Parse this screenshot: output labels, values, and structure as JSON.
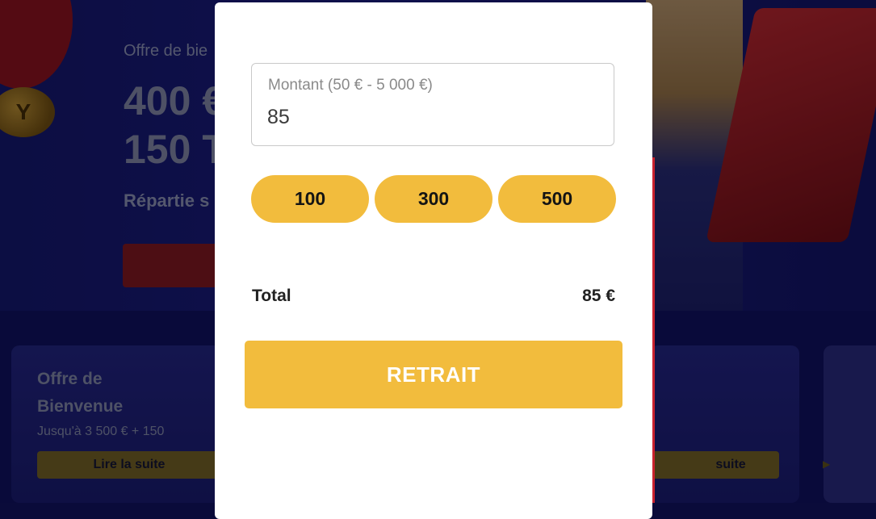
{
  "hero": {
    "offer_label": "Offre de bie",
    "line1": "400 €",
    "line2": "150 T",
    "subtitle": "Répartie s"
  },
  "promo_left": {
    "title_line1": "Offre de",
    "title_line2": "Bienvenue",
    "description": "Jusqu'à 3 500 € + 150",
    "button_label": "Lire la suite"
  },
  "promo_right": {
    "button_label": "suite"
  },
  "modal": {
    "amount_label": "Montant (50 € - 5 000 €)",
    "amount_value": "85",
    "quick_amounts": [
      "100",
      "300",
      "500"
    ],
    "total_label": "Total",
    "total_value": "85 €",
    "submit_label": "RETRAIT"
  },
  "colors": {
    "accent": "#f2bc3d",
    "background_blue": "#1b1c7e",
    "brand_red": "#c9232f"
  }
}
